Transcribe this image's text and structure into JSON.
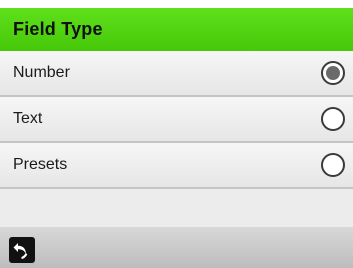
{
  "header": {
    "title": "Field Type"
  },
  "options": [
    {
      "label": "Number",
      "selected": true
    },
    {
      "label": "Text",
      "selected": false
    },
    {
      "label": "Presets",
      "selected": false
    }
  ],
  "footer": {
    "back_icon": "back-arrow-icon"
  },
  "colors": {
    "header": "#46c80a",
    "radio_selected": "#6a6a6a"
  }
}
